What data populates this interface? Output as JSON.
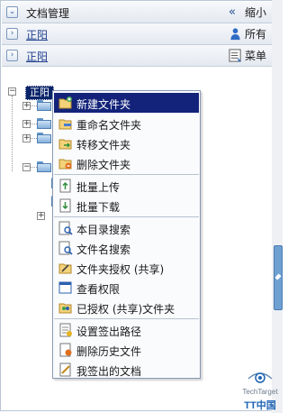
{
  "header": {
    "title": "文档管理",
    "minimize_label": "缩小"
  },
  "row2": {
    "title": "正阳",
    "all_label": "所有"
  },
  "row3": {
    "title": "正阳",
    "menu_label": "菜单"
  },
  "tree": {
    "root_label": "正阳"
  },
  "context_menu": {
    "items": [
      {
        "label": "新建文件夹",
        "icon": "new-folder-icon"
      },
      {
        "label": "重命名文件夹",
        "icon": "rename-folder-icon"
      },
      {
        "label": "转移文件夹",
        "icon": "move-folder-icon"
      },
      {
        "label": "删除文件夹",
        "icon": "delete-folder-icon"
      },
      {
        "label": "批量上传",
        "icon": "batch-upload-icon"
      },
      {
        "label": "批量下载",
        "icon": "batch-download-icon"
      },
      {
        "label": "本目录搜索",
        "icon": "dir-search-icon"
      },
      {
        "label": "文件名搜索",
        "icon": "filename-search-icon"
      },
      {
        "label": "文件夹授权 (共享)",
        "icon": "folder-share-icon"
      },
      {
        "label": "查看权限",
        "icon": "view-permission-icon"
      },
      {
        "label": "已授权 (共享)文件夹",
        "icon": "shared-folder-icon"
      },
      {
        "label": "设置签出路径",
        "icon": "checkout-path-icon"
      },
      {
        "label": "删除历史文件",
        "icon": "delete-history-icon"
      },
      {
        "label": "我签出的文档",
        "icon": "my-checkout-icon"
      }
    ]
  },
  "watermark": {
    "line1": "TechTarget",
    "line2": "TT中国"
  },
  "colors": {
    "menu_highlight": "#13237a",
    "link": "#1f3f8e",
    "scroll_thumb": "#6fa0d2"
  }
}
